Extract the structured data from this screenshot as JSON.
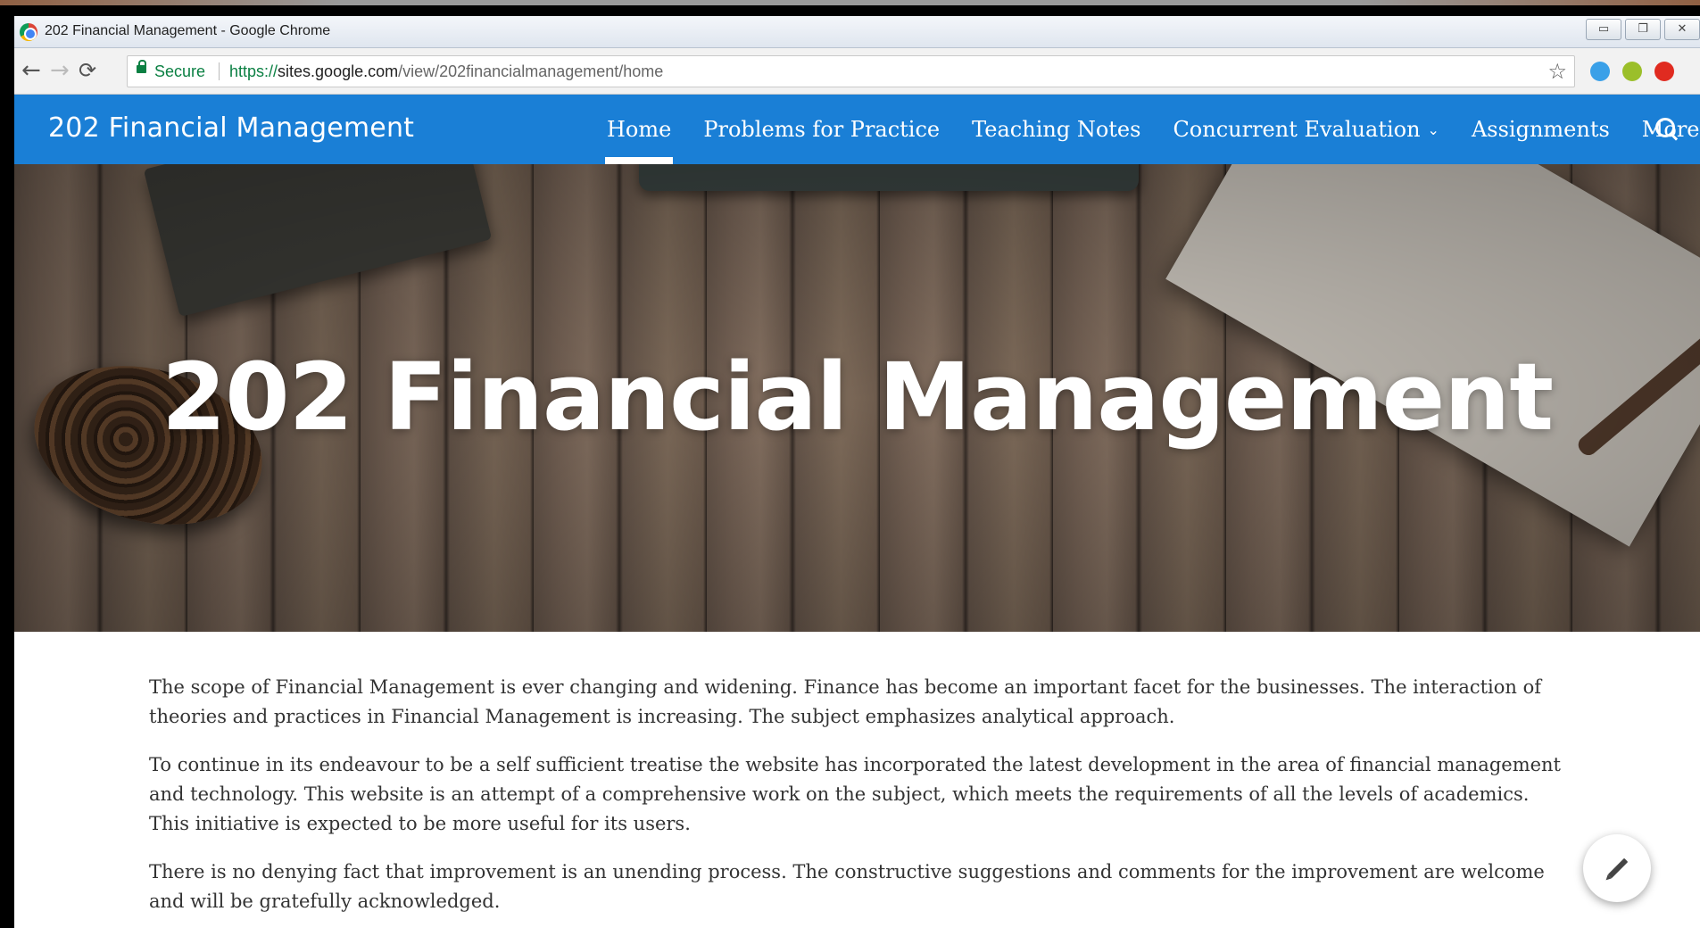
{
  "browser": {
    "window_title": "202 Financial Management - Google Chrome",
    "secure_label": "Secure",
    "url_scheme": "https://",
    "url_host": "sites.google.com",
    "url_path": "/view/202financialmanagement/home"
  },
  "site": {
    "name": "202 Financial Management",
    "nav": [
      {
        "label": "Home",
        "active": true
      },
      {
        "label": "Problems for Practice"
      },
      {
        "label": "Teaching Notes"
      },
      {
        "label": "Concurrent Evaluation",
        "has_dropdown": true
      },
      {
        "label": "Assignments"
      },
      {
        "label": "More",
        "has_dropdown": true
      }
    ],
    "accent_color": "#1a7fd6"
  },
  "hero": {
    "title": "202 Financial Management"
  },
  "content": {
    "paragraphs": [
      "The scope of Financial Management is ever changing and widening. Finance has become an important facet for the businesses. The interaction of theories and practices in Financial Management is increasing. The subject emphasizes analytical approach.",
      "To continue in its endeavour to be a self sufficient treatise the website has incorporated the latest development in the area of financial management and technology. This website is an attempt of a comprehensive work on the subject, which meets the requirements of all the levels of academics. This initiative is expected to be more useful for its users.",
      "There is no denying fact that improvement is an unending process. The constructive suggestions and comments for the improvement are welcome and will be gratefully acknowledged."
    ]
  },
  "icons": {
    "back": "back-arrow-icon",
    "forward": "forward-arrow-icon",
    "reload": "reload-icon",
    "lock": "lock-icon",
    "bookmark": "star-icon",
    "search": "search-icon",
    "edit": "pencil-icon"
  }
}
